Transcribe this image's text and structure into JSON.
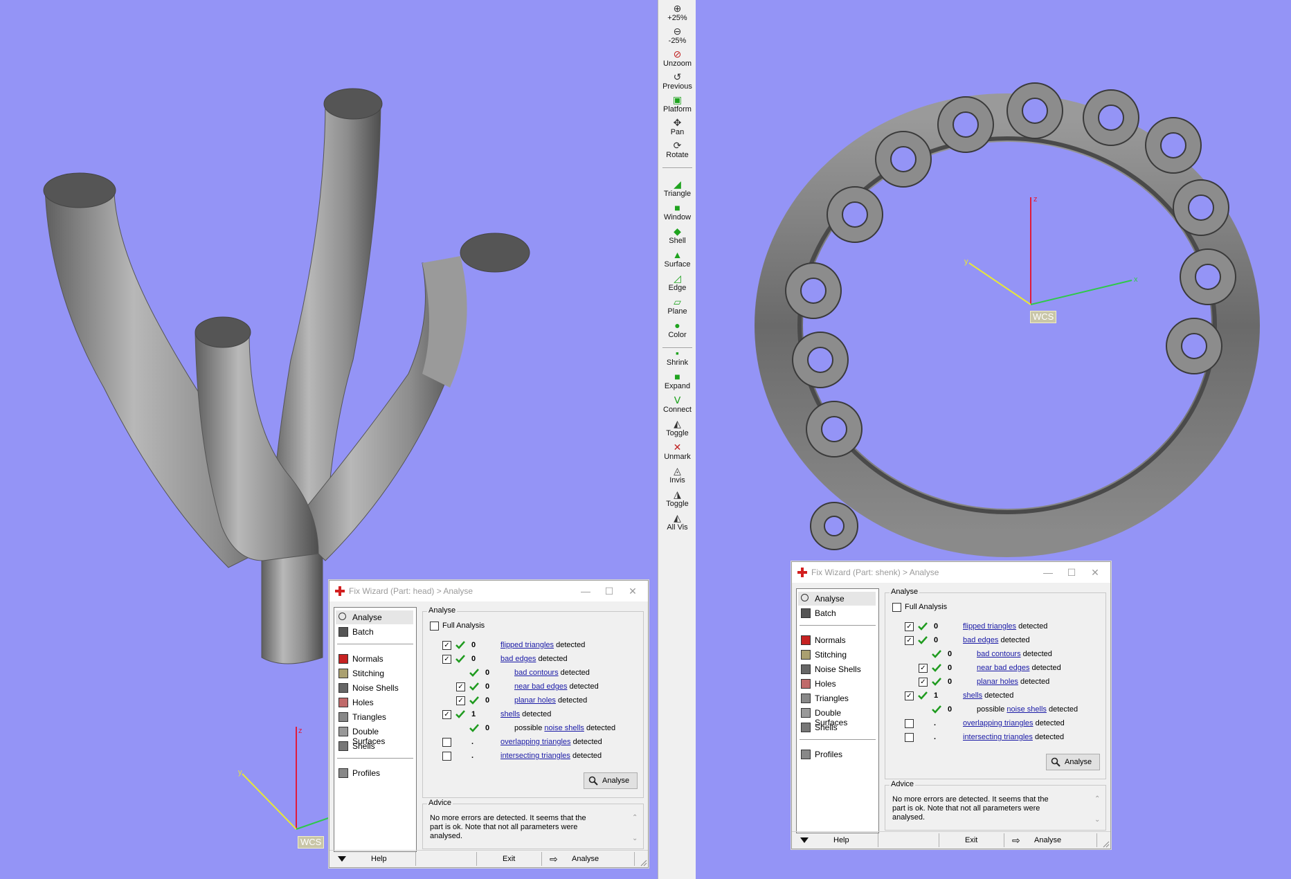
{
  "colors": {
    "background": "#9494f6",
    "link": "#1a1aa6",
    "check": "#1f9b1f",
    "axis_z": "#e01b3a",
    "axis_x": "#e8e838",
    "axis_y": "#2fc84a"
  },
  "toolbar": {
    "items": [
      {
        "label": "+25%",
        "icon": "zoom-in-icon"
      },
      {
        "label": "-25%",
        "icon": "zoom-out-icon"
      },
      {
        "label": "Unzoom",
        "icon": "unzoom-icon"
      },
      {
        "label": "Previous",
        "icon": "previous-view-icon"
      },
      {
        "label": "Platform",
        "icon": "platform-icon"
      },
      {
        "label": "Pan",
        "icon": "pan-icon"
      },
      {
        "label": "Rotate",
        "icon": "rotate-icon"
      },
      {
        "label": "Triangle",
        "icon": "select-triangle-icon"
      },
      {
        "label": "Window",
        "icon": "select-window-icon"
      },
      {
        "label": "Shell",
        "icon": "select-shell-icon"
      },
      {
        "label": "Surface",
        "icon": "select-surface-icon"
      },
      {
        "label": "Edge",
        "icon": "select-edge-icon"
      },
      {
        "label": "Plane",
        "icon": "select-plane-icon"
      },
      {
        "label": "Color",
        "icon": "select-color-icon"
      },
      {
        "label": "Shrink",
        "icon": "shrink-icon"
      },
      {
        "label": "Expand",
        "icon": "expand-icon"
      },
      {
        "label": "Connect",
        "icon": "connect-icon"
      },
      {
        "label": "Toggle",
        "icon": "toggle-icon"
      },
      {
        "label": "Unmark",
        "icon": "unmark-icon"
      },
      {
        "label": "Invis",
        "icon": "invisible-icon"
      },
      {
        "label": "Toggle",
        "icon": "toggle-visibility-icon"
      },
      {
        "label": "All Vis",
        "icon": "all-visible-icon"
      }
    ]
  },
  "left_view": {
    "wcs_label": "WCS",
    "axis_z_label": "z",
    "axis_y_label": "y"
  },
  "right_view": {
    "wcs_label": "WCS",
    "axis_z_label": "z",
    "axis_y_label": "y",
    "axis_x_label": "x"
  },
  "dialogs": [
    {
      "title": "Fix Wizard (Part: head) > Analyse",
      "nav": {
        "top": [
          {
            "label": "Analyse",
            "icon": "magnifier-icon"
          },
          {
            "label": "Batch",
            "icon": "batch-icon"
          }
        ],
        "middle": [
          {
            "label": "Normals",
            "icon": "normals-icon"
          },
          {
            "label": "Stitching",
            "icon": "stitching-icon"
          },
          {
            "label": "Noise Shells",
            "icon": "noise-shells-icon"
          },
          {
            "label": "Holes",
            "icon": "holes-icon"
          },
          {
            "label": "Triangles",
            "icon": "triangles-icon"
          },
          {
            "label": "Double Surfaces",
            "icon": "double-surfaces-icon"
          },
          {
            "label": "Shells",
            "icon": "shells-icon"
          }
        ],
        "bottom": [
          {
            "label": "Profiles",
            "icon": "profiles-icon"
          }
        ]
      },
      "analyse": {
        "group_label": "Analyse",
        "full_analysis_label": "Full Analysis",
        "rows": [
          {
            "checkbox": "✓",
            "status": "ok",
            "value": "0",
            "link": "flipped triangles",
            "prefix": "",
            "suffix": " detected",
            "indent": 0
          },
          {
            "checkbox": "✓",
            "status": "ok",
            "value": "0",
            "link": "bad edges",
            "prefix": "",
            "suffix": " detected",
            "indent": 0
          },
          {
            "checkbox": "",
            "status": "ok",
            "value": "0",
            "link": "bad contours",
            "prefix": "",
            "suffix": " detected",
            "indent": 1
          },
          {
            "checkbox": "✓",
            "status": "ok",
            "value": "0",
            "link": "near bad edges",
            "prefix": "",
            "suffix": " detected",
            "indent": 1
          },
          {
            "checkbox": "✓",
            "status": "ok",
            "value": "0",
            "link": "planar holes",
            "prefix": "",
            "suffix": " detected",
            "indent": 1
          },
          {
            "checkbox": "✓",
            "status": "ok",
            "value": "1",
            "link": "shells",
            "prefix": "",
            "suffix": " detected",
            "indent": 0
          },
          {
            "checkbox": "",
            "status": "ok",
            "value": "0",
            "link": "noise shells",
            "prefix": "possible ",
            "suffix": " detected",
            "indent": 1
          },
          {
            "checkbox": "",
            "status": "none",
            "value": ".",
            "link": "overlapping triangles",
            "prefix": "",
            "suffix": " detected",
            "indent": 0
          },
          {
            "checkbox": "",
            "status": "none",
            "value": ".",
            "link": "intersecting triangles",
            "prefix": "",
            "suffix": " detected",
            "indent": 0
          }
        ],
        "button_label": "Analyse"
      },
      "advice": {
        "group_label": "Advice",
        "text": "No more errors are detected. It seems that the part is ok. Note that not all parameters were analysed."
      },
      "footer": {
        "help": "Help",
        "exit": "Exit",
        "analyse": "Analyse"
      }
    },
    {
      "title": "Fix Wizard (Part: shenk) > Analyse",
      "nav": {
        "top": [
          {
            "label": "Analyse",
            "icon": "magnifier-icon"
          },
          {
            "label": "Batch",
            "icon": "batch-icon"
          }
        ],
        "middle": [
          {
            "label": "Normals",
            "icon": "normals-icon"
          },
          {
            "label": "Stitching",
            "icon": "stitching-icon"
          },
          {
            "label": "Noise Shells",
            "icon": "noise-shells-icon"
          },
          {
            "label": "Holes",
            "icon": "holes-icon"
          },
          {
            "label": "Triangles",
            "icon": "triangles-icon"
          },
          {
            "label": "Double Surfaces",
            "icon": "double-surfaces-icon"
          },
          {
            "label": "Shells",
            "icon": "shells-icon"
          }
        ],
        "bottom": [
          {
            "label": "Profiles",
            "icon": "profiles-icon"
          }
        ]
      },
      "analyse": {
        "group_label": "Analyse",
        "full_analysis_label": "Full Analysis",
        "rows": [
          {
            "checkbox": "✓",
            "status": "ok",
            "value": "0",
            "link": "flipped triangles",
            "prefix": "",
            "suffix": " detected",
            "indent": 0
          },
          {
            "checkbox": "✓",
            "status": "ok",
            "value": "0",
            "link": "bad edges",
            "prefix": "",
            "suffix": " detected",
            "indent": 0
          },
          {
            "checkbox": "",
            "status": "ok",
            "value": "0",
            "link": "bad contours",
            "prefix": "",
            "suffix": " detected",
            "indent": 1
          },
          {
            "checkbox": "✓",
            "status": "ok",
            "value": "0",
            "link": "near bad edges",
            "prefix": "",
            "suffix": " detected",
            "indent": 1
          },
          {
            "checkbox": "✓",
            "status": "ok",
            "value": "0",
            "link": "planar holes",
            "prefix": "",
            "suffix": " detected",
            "indent": 1
          },
          {
            "checkbox": "✓",
            "status": "ok",
            "value": "1",
            "link": "shells",
            "prefix": "",
            "suffix": " detected",
            "indent": 0
          },
          {
            "checkbox": "",
            "status": "ok",
            "value": "0",
            "link": "noise shells",
            "prefix": "possible ",
            "suffix": " detected",
            "indent": 1
          },
          {
            "checkbox": "",
            "status": "none",
            "value": ".",
            "link": "overlapping triangles",
            "prefix": "",
            "suffix": " detected",
            "indent": 0
          },
          {
            "checkbox": "",
            "status": "none",
            "value": ".",
            "link": "intersecting triangles",
            "prefix": "",
            "suffix": " detected",
            "indent": 0
          }
        ],
        "button_label": "Analyse"
      },
      "advice": {
        "group_label": "Advice",
        "text": "No more errors are detected. It seems that the part is ok. Note that not all parameters were analysed."
      },
      "footer": {
        "help": "Help",
        "exit": "Exit",
        "analyse": "Analyse"
      }
    }
  ]
}
